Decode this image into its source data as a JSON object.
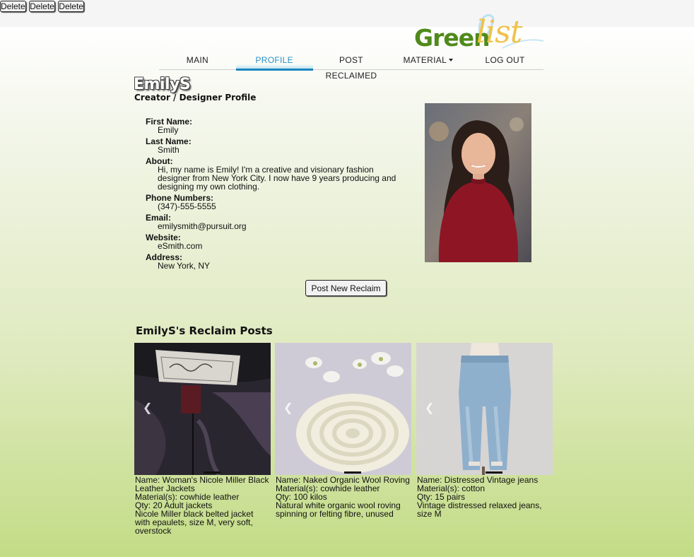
{
  "brand": {
    "part1": "Green",
    "part2": "list"
  },
  "nav": {
    "tabs": [
      {
        "label": "MAIN"
      },
      {
        "label": "PROFILE",
        "active": true
      },
      {
        "label": "POST RECLAIMED"
      },
      {
        "label": "MATERIAL"
      },
      {
        "label": "LOG OUT"
      }
    ]
  },
  "profile": {
    "username": "EmilyS",
    "subtitle": "Creator / Designer Profile",
    "fields": [
      {
        "label": "First Name:",
        "value": "Emily"
      },
      {
        "label": "Last Name:",
        "value": "Smith"
      },
      {
        "label": "About:",
        "value": "Hi, my name is Emily! I'm a creative and visionary fashion designer from New York City. I now have 9 years producing and designing my own clothing."
      },
      {
        "label": "Phone Numbers:",
        "value": "(347)-555-5555"
      },
      {
        "label": "Email:",
        "value": "emilysmith@pursuit.org"
      },
      {
        "label": "Website:",
        "value": "eSmith.com"
      },
      {
        "label": "Address:",
        "value": "New York, NY"
      }
    ],
    "post_button": "Post New Reclaim"
  },
  "posts": {
    "title": "EmilyS's Reclaim Posts",
    "delete_label": "Delete",
    "items": [
      {
        "name": "Name: Woman's Nicole Miller Black Leather Jackets",
        "material": "Material(s): cowhide leather",
        "qty": "Qty: 20 Adult jackets",
        "desc": "Nicole Miller black belted jacket with epaulets, size M, very soft, overstock"
      },
      {
        "name": "Name: Naked Organic Wool Roving",
        "material": "Material(s): cowhide leather",
        "qty": "Qty: 100 kilos",
        "desc": "Natural white organic wool roving spinning or felting fibre, unused"
      },
      {
        "name": "Name: Distressed Vintage jeans",
        "material": "Material(s): cotton",
        "qty": "Qty: 15 pairs",
        "desc": "Vintage distressed relaxed jeans, size M"
      }
    ]
  },
  "colors": {
    "accent": "#2a8fc7",
    "brand_green": "#4f8a1a",
    "brand_yellow": "#f0c24c"
  }
}
